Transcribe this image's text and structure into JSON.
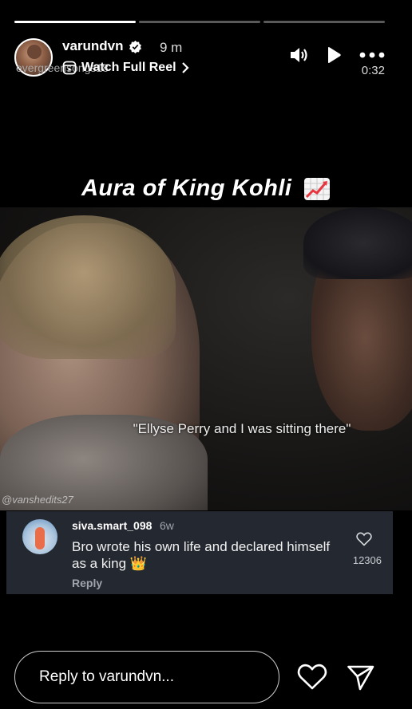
{
  "progress": [
    1.0,
    0.0,
    0.0
  ],
  "header": {
    "username": "varundvn",
    "time": "9 m",
    "audio": "evergreensongs18",
    "watch_label": "Watch Full Reel",
    "duration": "0:32"
  },
  "icons": {
    "verified": "verified-badge-icon",
    "sound": "speaker-icon",
    "play": "play-icon",
    "more": "more-icon",
    "watch": "reel-icon",
    "chevron": "chevron-right-icon",
    "like": "heart-icon",
    "send": "send-icon"
  },
  "video": {
    "caption": "Aura of King Kohli",
    "subtitle": "\"Ellyse Perry and I was sitting there\"",
    "watermark": "@vanshedits27"
  },
  "comment": {
    "user": "siva.smart_098",
    "age": "6w",
    "text": "Bro wrote his own life and declared himself as a king 👑",
    "reply_label": "Reply",
    "likes": "12306"
  },
  "footer": {
    "reply_placeholder": "Reply to varundvn..."
  },
  "colors": {
    "background": "#000000",
    "comment_bg": "#242830",
    "chart_emoji_line": "#e8363f"
  }
}
